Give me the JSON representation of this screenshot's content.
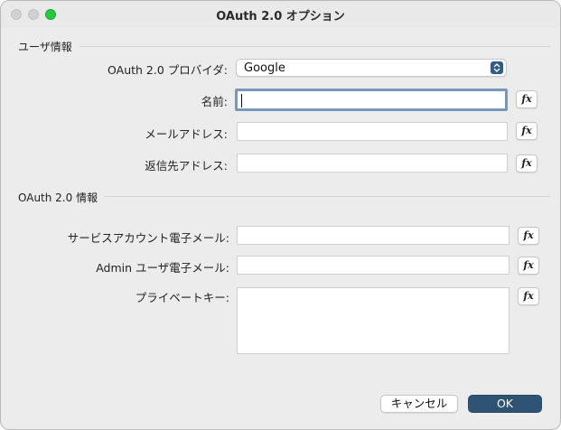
{
  "window": {
    "title": "OAuth 2.0 オプション"
  },
  "user_section": {
    "heading": "ユーザ情報",
    "provider_label": "OAuth 2.0 プロバイダ:",
    "provider_value": "Google",
    "name_label": "名前:",
    "name_value": "",
    "email_label": "メールアドレス:",
    "email_value": "",
    "reply_label": "返信先アドレス:",
    "reply_value": ""
  },
  "oauth_section": {
    "heading": "OAuth 2.0 情報",
    "service_email_label": "サービスアカウント電子メール:",
    "service_email_value": "",
    "admin_email_label": "Admin ユーザ電子メール:",
    "admin_email_value": "",
    "private_key_label": "プライベートキー:",
    "private_key_value": ""
  },
  "fx_button_label": "fx",
  "buttons": {
    "cancel": "キャンセル",
    "ok": "OK"
  },
  "icons": {
    "stepper": "popup-stepper-icon"
  },
  "colors": {
    "ok_button": "#2e5373",
    "focus_ring": "#7a96b8",
    "stepper": "#2f5d8a",
    "zoom_button": "#28c840"
  }
}
